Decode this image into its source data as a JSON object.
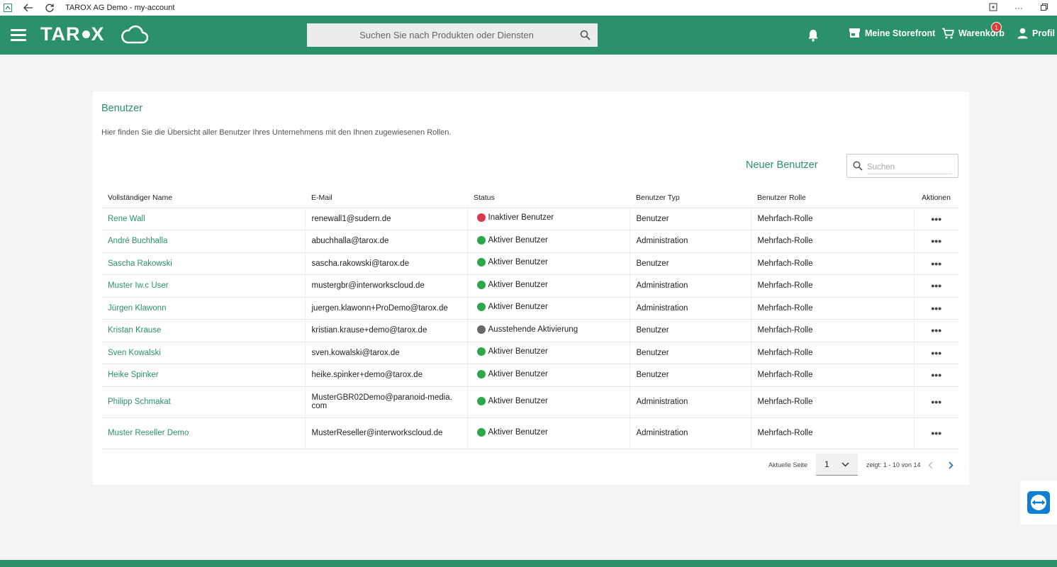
{
  "window": {
    "title": "TAROX AG Demo - my-account",
    "controls": [
      "app-share-icon",
      "more-icon",
      "restore-icon"
    ]
  },
  "header": {
    "logo_text_left": "TAR",
    "logo_text_right": "X",
    "search_placeholder": "Suchen Sie nach Produkten oder Diensten",
    "storefront_label": "Meine Storefront",
    "cart_label": "Warenkorb",
    "cart_badge": "1",
    "profile_label": "Profil",
    "brand_color": "#2a9169"
  },
  "card": {
    "title": "Benutzer",
    "description": "Hier finden Sie die Übersicht aller Benutzer Ihres Unternehmens mit den Ihnen zugewiesenen Rollen.",
    "new_user_label": "Neuer Benutzer",
    "search_placeholder": "Suchen"
  },
  "table": {
    "headers": {
      "name": "Vollständiger Name",
      "email": "E-Mail",
      "status": "Status",
      "typ": "Benutzer Typ",
      "rolle": "Benutzer Rolle",
      "aktionen": "Aktionen"
    },
    "status_colors": {
      "inactive": "#d93a4a",
      "active": "#2aa84a",
      "pending": "#666666"
    },
    "rows": [
      {
        "name": "Rene Wall",
        "email": "renewall1@sudern.de",
        "status": "Inaktiver Benutzer",
        "status_kind": "inactive",
        "typ": "Benutzer",
        "rolle": "Mehrfach-Rolle",
        "action": "•••"
      },
      {
        "name": "André Buchhalla",
        "email": "abuchhalla@tarox.de",
        "status": "Aktiver Benutzer",
        "status_kind": "active",
        "typ": "Administration",
        "rolle": "Mehrfach-Rolle",
        "action": "•••"
      },
      {
        "name": "Sascha Rakowski",
        "email": "sascha.rakowski@tarox.de",
        "status": "Aktiver Benutzer",
        "status_kind": "active",
        "typ": "Benutzer",
        "rolle": "Mehrfach-Rolle",
        "action": "•••"
      },
      {
        "name": "Muster Iw.c User",
        "email": "mustergbr@interworkscloud.de",
        "status": "Aktiver Benutzer",
        "status_kind": "active",
        "typ": "Administration",
        "rolle": "Mehrfach-Rolle",
        "action": "•••"
      },
      {
        "name": "Jürgen Klawonn",
        "email": "juergen.klawonn+ProDemo@tarox.de",
        "status": "Aktiver Benutzer",
        "status_kind": "active",
        "typ": "Administration",
        "rolle": "Mehrfach-Rolle",
        "action": "•••"
      },
      {
        "name": "Kristan Krause",
        "email": "kristian.krause+demo@tarox.de",
        "status": "Ausstehende Aktivierung",
        "status_kind": "pending",
        "typ": "Benutzer",
        "rolle": "Mehrfach-Rolle",
        "action": "•••"
      },
      {
        "name": "Sven Kowalski",
        "email": "sven.kowalski@tarox.de",
        "status": "Aktiver Benutzer",
        "status_kind": "active",
        "typ": "Benutzer",
        "rolle": "Mehrfach-Rolle",
        "action": "•••"
      },
      {
        "name": "Heike Spinker",
        "email": "heike.spinker+demo@tarox.de",
        "status": "Aktiver Benutzer",
        "status_kind": "active",
        "typ": "Benutzer",
        "rolle": "Mehrfach-Rolle",
        "action": "•••"
      },
      {
        "name": "Philipp Schmakat",
        "email": "MusterGBR02Demo@paranoid-media.com",
        "status": "Aktiver Benutzer",
        "status_kind": "active",
        "typ": "Administration",
        "rolle": "Mehrfach-Rolle",
        "action": "•••"
      },
      {
        "name": "Muster Reseller Demo",
        "email": "MusterReseller@interworkscloud.de",
        "status": "Aktiver Benutzer",
        "status_kind": "active",
        "typ": "Administration",
        "rolle": "Mehrfach-Rolle",
        "action": "•••"
      }
    ]
  },
  "pagination": {
    "current_page_label": "Aktuelle Seite",
    "current_page": "1",
    "info": "zeigt: 1 - 10 von 14"
  }
}
